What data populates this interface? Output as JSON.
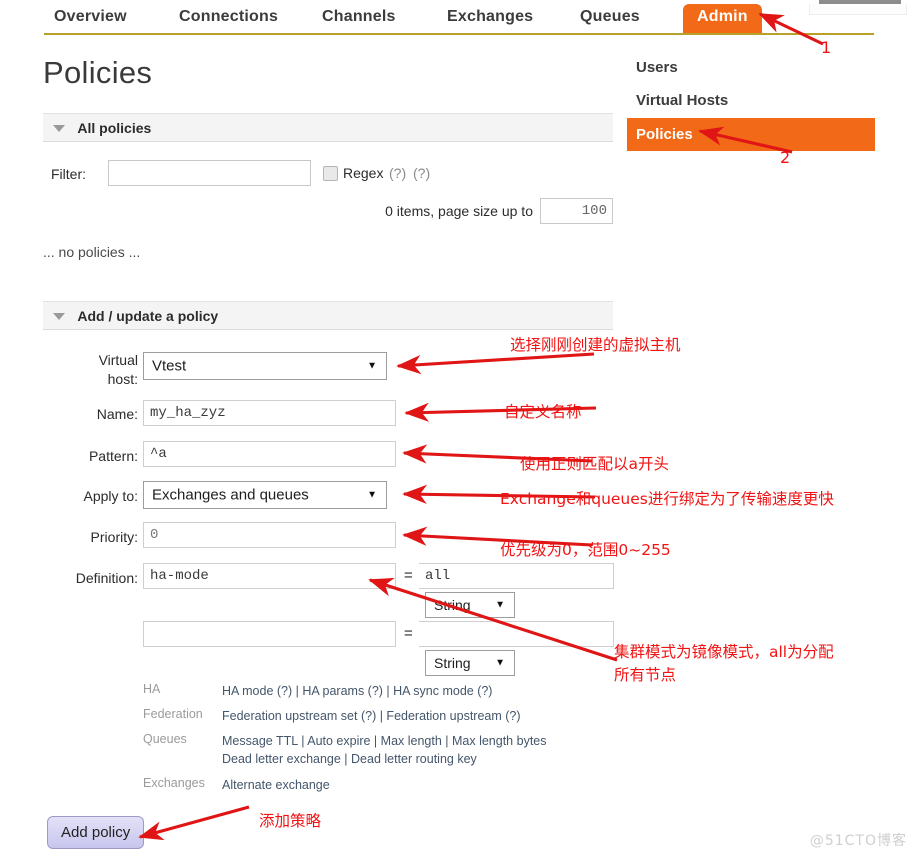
{
  "nav": {
    "items": [
      {
        "label": "Overview",
        "active": false
      },
      {
        "label": "Connections",
        "active": false
      },
      {
        "label": "Channels",
        "active": false
      },
      {
        "label": "Exchanges",
        "active": false
      },
      {
        "label": "Queues",
        "active": false
      },
      {
        "label": "Admin",
        "active": true
      }
    ]
  },
  "page": {
    "title": "Policies"
  },
  "sidebar": {
    "items": [
      {
        "label": "Users",
        "selected": false
      },
      {
        "label": "Virtual Hosts",
        "selected": false
      },
      {
        "label": "Policies",
        "selected": true
      }
    ]
  },
  "all_policies": {
    "section_title": "All policies",
    "filter_label": "Filter:",
    "filter_value": "",
    "filter_placeholder": "",
    "regex_label": "Regex",
    "regex_help_1": "(?)",
    "regex_help_2": "(?)",
    "regex_checked": false,
    "paging_text": "0 items, page size up to",
    "page_size_value": "100",
    "empty_text": "... no policies ..."
  },
  "add_policy": {
    "section_title": "Add / update a policy",
    "fields": {
      "vhost_label_line1": "Virtual",
      "vhost_label_line2": "host:",
      "vhost_value": "Vtest",
      "name_label": "Name:",
      "name_value": "my_ha_zyz",
      "pattern_label": "Pattern:",
      "pattern_value": "^a",
      "apply_to_label": "Apply to:",
      "apply_to_value": "Exchanges and queues",
      "priority_label": "Priority:",
      "priority_value": "0",
      "definition_label": "Definition:",
      "def_row1_key": "ha-mode",
      "def_row1_eq": "=",
      "def_row1_value": "all",
      "def_row1_type": "String",
      "def_row2_key": "",
      "def_row2_eq": "=",
      "def_row2_value": "",
      "def_row2_type": "String"
    },
    "hints": [
      {
        "key": "HA",
        "items": [
          "HA mode",
          "HA params",
          "HA sync mode"
        ],
        "help": true
      },
      {
        "key": "Federation",
        "items": [
          "Federation upstream set",
          "Federation upstream"
        ],
        "help": true
      },
      {
        "key": "Queues",
        "items": [
          "Message TTL",
          "Auto expire",
          "Max length",
          "Max length bytes",
          "Dead letter exchange",
          "Dead letter routing key"
        ],
        "help": false
      },
      {
        "key": "Exchanges",
        "items": [
          "Alternate exchange"
        ],
        "help": false
      }
    ],
    "hint_ha_line": "HA mode (?) | HA params (?) | HA sync mode (?)",
    "hint_federation_line": "Federation upstream set (?) | Federation upstream (?)",
    "hint_queues_line1": "Message TTL | Auto expire | Max length | Max length bytes",
    "hint_queues_line2": "Dead letter exchange | Dead letter routing key",
    "hint_exchanges_line": "Alternate exchange",
    "submit_label": "Add policy"
  },
  "annotations": {
    "marker_1": "1",
    "marker_2": "2",
    "vhost_note": "选择刚刚创建的虚拟主机",
    "name_note": "自定义名称",
    "pattern_note": "使用正则匹配以a开头",
    "apply_note": "Exchange和queues进行绑定为了传输速度更快",
    "priority_note": "优先级为0，范围0~255",
    "definition_note_line1": "集群模式为镜像模式，all为分配",
    "definition_note_line2": "所有节点",
    "submit_note": "添加策略",
    "color": "#f11313"
  },
  "watermark": "@51CTO博客"
}
